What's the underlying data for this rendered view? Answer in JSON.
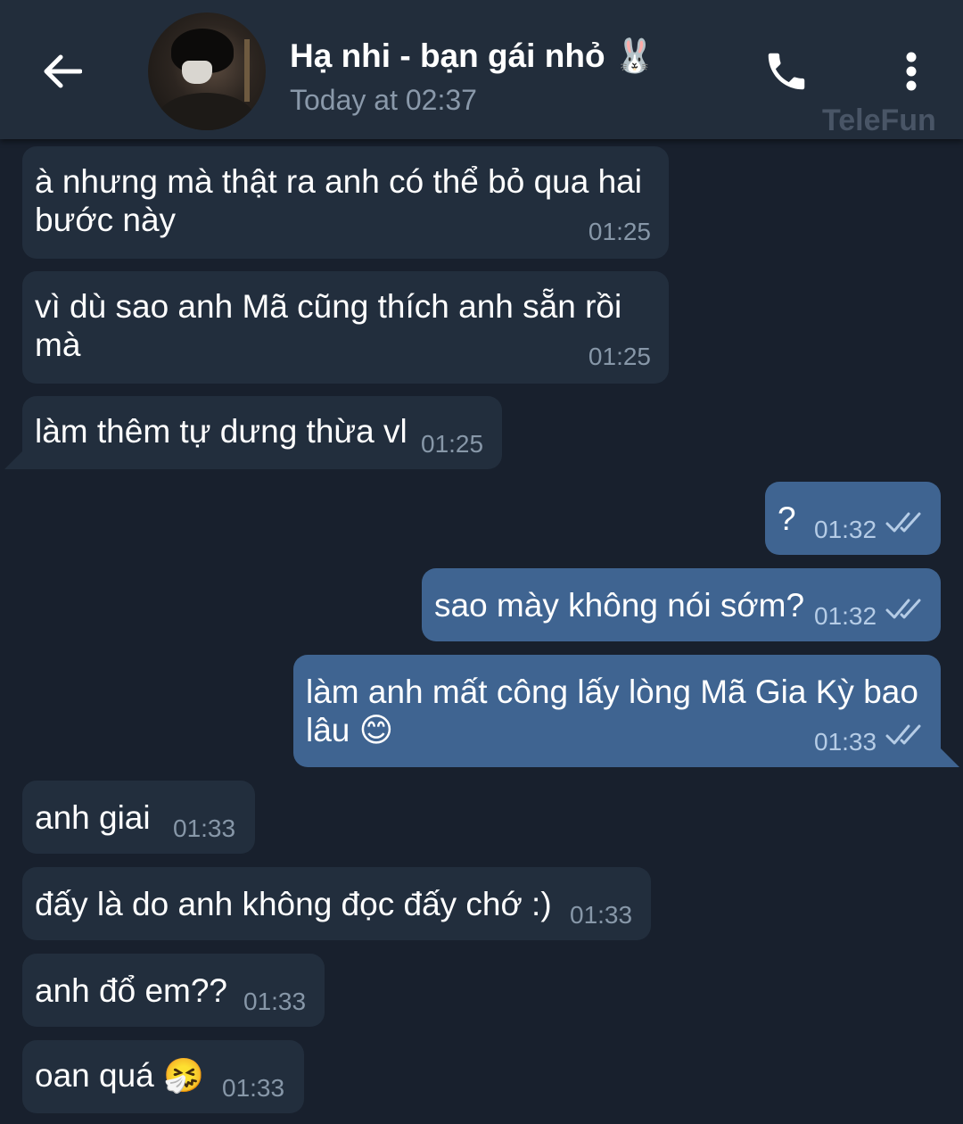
{
  "header": {
    "contact_name": "Hạ nhi - bạn gái nhỏ 🐰",
    "status": "Today at 02:37",
    "watermark": "TeleFun",
    "icons": {
      "back": "back-arrow-icon",
      "call": "phone-icon",
      "menu": "more-vertical-icon"
    }
  },
  "messages": [
    {
      "direction": "incoming",
      "lines": [
        "à nhưng mà thật ra anh có thể bỏ qua hai",
        "bước này"
      ],
      "time": "01:25"
    },
    {
      "direction": "incoming",
      "lines": [
        "vì dù sao anh Mã cũng thích anh sẵn rồi",
        "mà"
      ],
      "time": "01:25"
    },
    {
      "direction": "incoming",
      "lines": [
        "làm thêm tự dưng thừa vl"
      ],
      "time": "01:25"
    },
    {
      "direction": "outgoing",
      "lines": [
        "?"
      ],
      "time": "01:32",
      "read": true
    },
    {
      "direction": "outgoing",
      "lines": [
        "sao mày không nói sớm?"
      ],
      "time": "01:32",
      "read": true
    },
    {
      "direction": "outgoing",
      "lines": [
        "làm anh mất công lấy lòng Mã Gia Kỳ bao",
        "lâu 😊"
      ],
      "time": "01:33",
      "read": true
    },
    {
      "direction": "incoming",
      "lines": [
        "anh giai"
      ],
      "time": "01:33"
    },
    {
      "direction": "incoming",
      "lines": [
        "đấy là do anh không đọc đấy chớ :)"
      ],
      "time": "01:33"
    },
    {
      "direction": "incoming",
      "lines": [
        "anh đổ em??"
      ],
      "time": "01:33"
    },
    {
      "direction": "incoming",
      "lines": [
        "oan quá 🤧"
      ],
      "time": "01:33"
    }
  ],
  "colors": {
    "background": "#18202d",
    "header": "#222d3b",
    "incoming_bubble": "#222e3d",
    "outgoing_bubble": "#3f6491",
    "read_check": "#b5cce6"
  }
}
